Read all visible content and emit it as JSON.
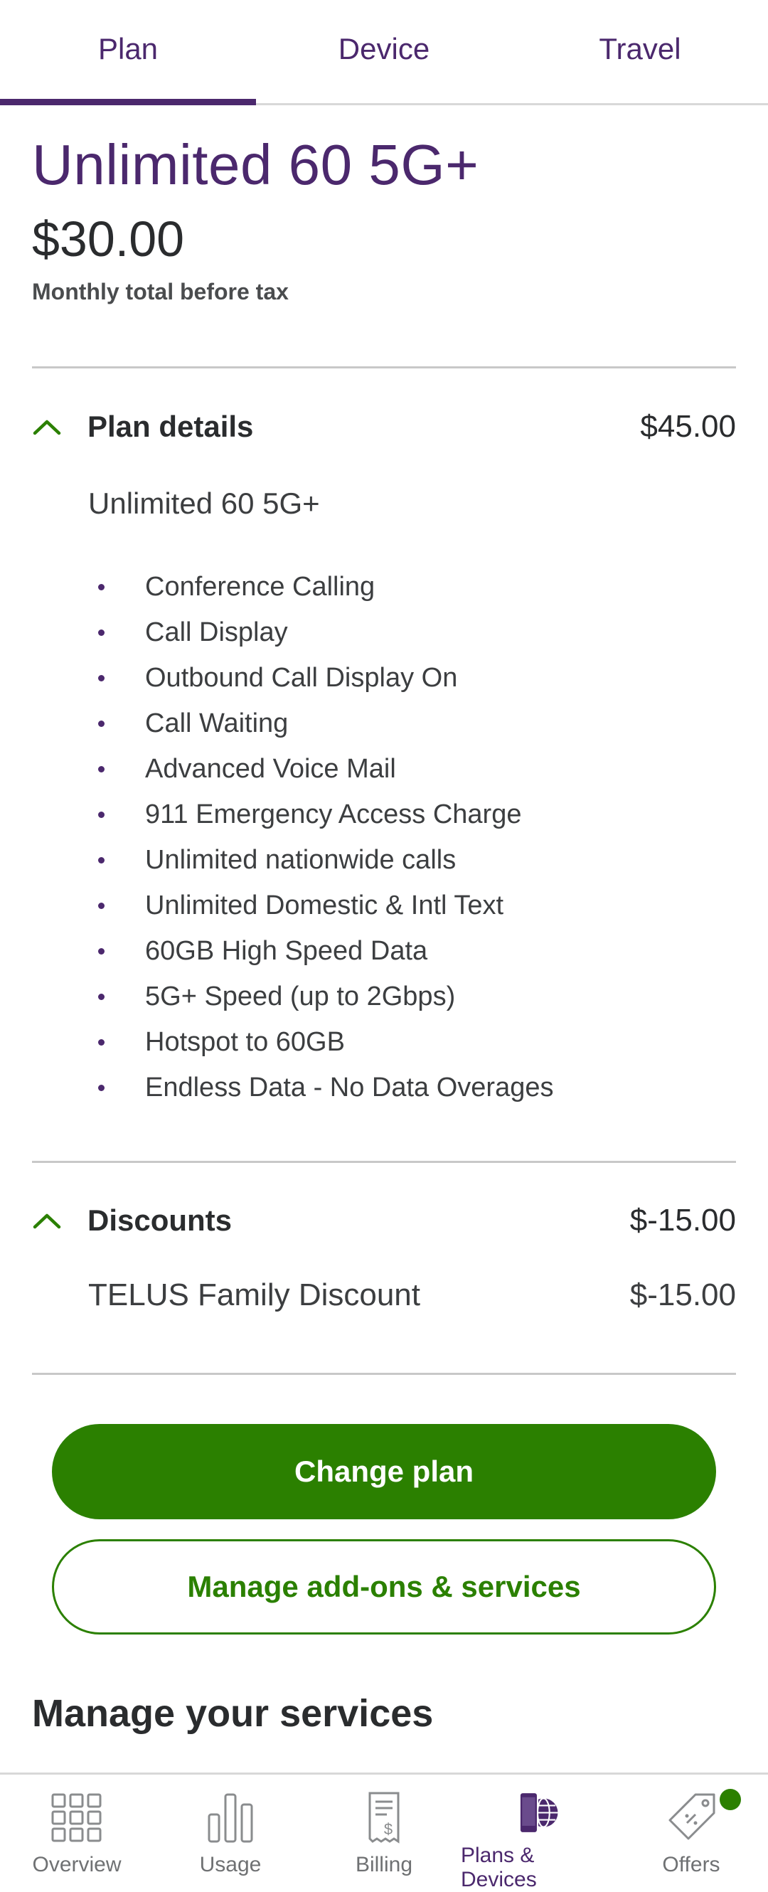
{
  "tabs": [
    {
      "label": "Plan",
      "active": true
    },
    {
      "label": "Device",
      "active": false
    },
    {
      "label": "Travel",
      "active": false
    }
  ],
  "plan": {
    "name": "Unlimited 60 5G+",
    "price": "$30.00",
    "price_subtitle": "Monthly total before tax"
  },
  "plan_details": {
    "title": "Plan details",
    "amount": "$45.00",
    "expanded": true,
    "plan_name": "Unlimited 60 5G+",
    "features": [
      "Conference Calling",
      "Call Display",
      "Outbound Call Display On",
      "Call Waiting",
      "Advanced Voice Mail",
      "911 Emergency Access Charge",
      "Unlimited nationwide calls",
      "Unlimited Domestic & Intl Text",
      "60GB High Speed Data",
      "5G+ Speed (up to 2Gbps)",
      "Hotspot to 60GB",
      "Endless Data - No Data Overages"
    ]
  },
  "discounts": {
    "title": "Discounts",
    "amount": "$-15.00",
    "expanded": true,
    "items": [
      {
        "name": "TELUS Family Discount",
        "amount": "$-15.00"
      }
    ]
  },
  "actions": {
    "change_plan": "Change plan",
    "manage_addons": "Manage add-ons & services"
  },
  "services": {
    "title": "Manage your services"
  },
  "bottom_nav": [
    {
      "label": "Overview",
      "icon": "grid-icon",
      "active": false
    },
    {
      "label": "Usage",
      "icon": "bar-chart-icon",
      "active": false
    },
    {
      "label": "Billing",
      "icon": "receipt-icon",
      "active": false
    },
    {
      "label": "Plans & Devices",
      "icon": "devices-globe-icon",
      "active": true
    },
    {
      "label": "Offers",
      "icon": "tag-icon",
      "active": false,
      "notification": true
    }
  ],
  "colors": {
    "brand_purple": "#4b286d",
    "brand_green": "#2b8000"
  }
}
